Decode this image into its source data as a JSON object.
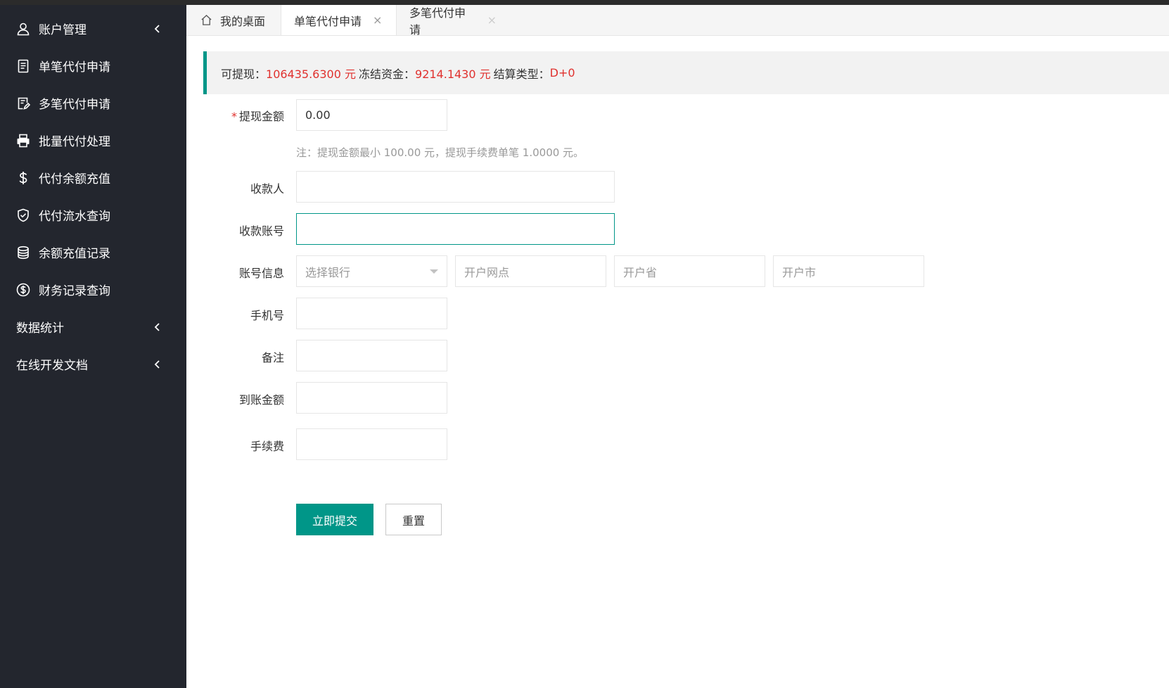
{
  "sidebar": {
    "items": [
      {
        "label": "账户管理",
        "icon": "user-icon",
        "caret": true
      },
      {
        "label": "单笔代付申请",
        "icon": "document-icon"
      },
      {
        "label": "多笔代付申请",
        "icon": "document-edit-icon"
      },
      {
        "label": "批量代付处理",
        "icon": "printer-icon"
      },
      {
        "label": "代付余额充值",
        "icon": "dollar-icon"
      },
      {
        "label": "代付流水查询",
        "icon": "shield-check-icon"
      },
      {
        "label": "余额充值记录",
        "icon": "database-icon"
      },
      {
        "label": "财务记录查询",
        "icon": "dollar-circle-icon"
      },
      {
        "label": "数据统计",
        "icon": "",
        "caret": true
      },
      {
        "label": "在线开发文档",
        "icon": "",
        "caret": true
      }
    ]
  },
  "tabs": {
    "home": "我的桌面",
    "tab1": "单笔代付申请",
    "tab2": "多笔代付申请",
    "close": "×"
  },
  "notice": {
    "withdrawable_label": "可提现：",
    "withdrawable_value": "106435.6300 元",
    "frozen_label": "冻结资金：",
    "frozen_value": "9214.1430 元",
    "settle_label": "结算类型：",
    "settle_value": "D+0"
  },
  "form": {
    "amount_required_mark": "*",
    "amount_label": "提现金额",
    "amount_value": "0.00",
    "hint": "注：提现金额最小 100.00 元，提现手续费单笔 1.0000 元。",
    "payee_label": "收款人",
    "account_label": "收款账号",
    "account_info_label": "账号信息",
    "bank_placeholder": "选择银行",
    "branch_placeholder": "开户网点",
    "province_placeholder": "开户省",
    "city_placeholder": "开户市",
    "phone_label": "手机号",
    "remark_label": "备注",
    "arrival_label": "到账金额",
    "fee_label": "手续费",
    "submit_label": "立即提交",
    "reset_label": "重置"
  },
  "colors": {
    "sidebar_bg": "#23262e",
    "accent": "#009688",
    "money_red": "#e0312e"
  }
}
